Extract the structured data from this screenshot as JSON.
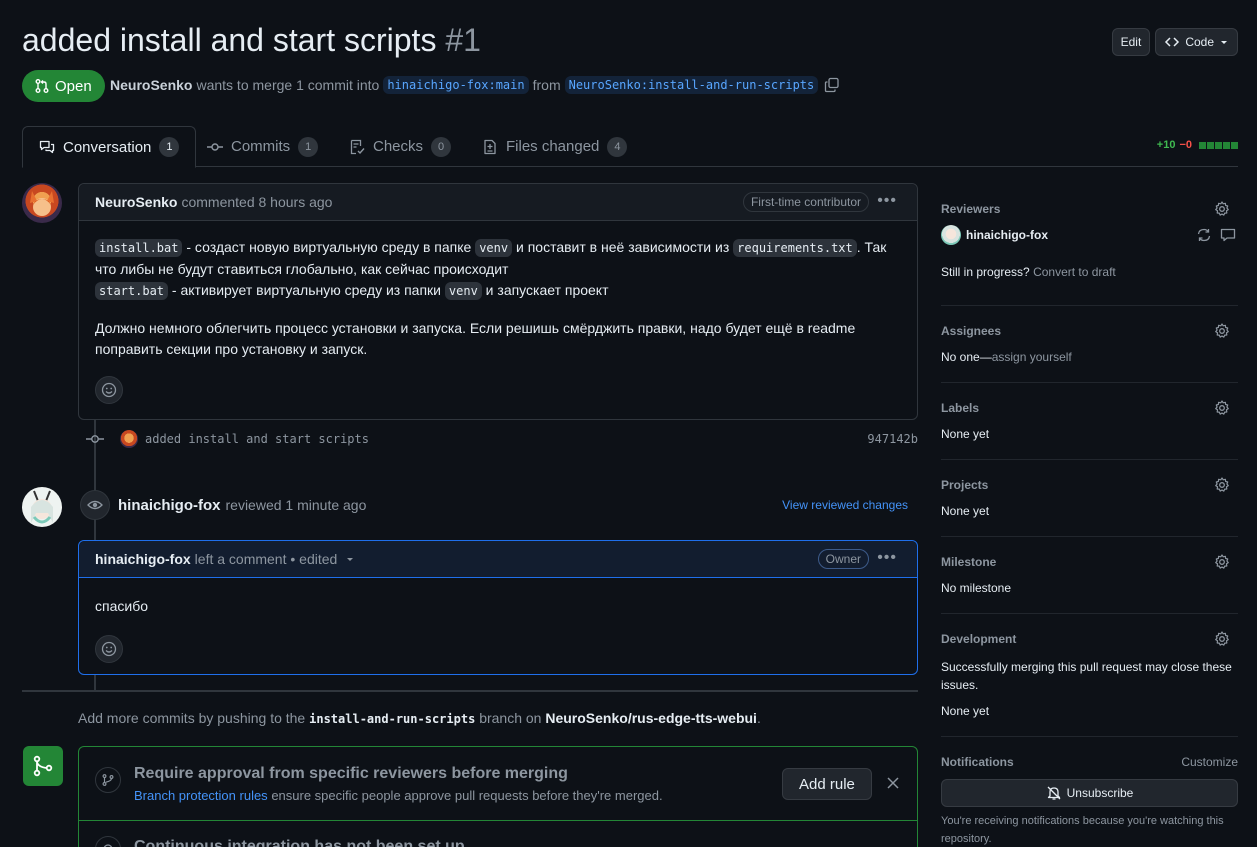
{
  "header": {
    "title": "added install and start scripts",
    "number": "#1",
    "edit_label": "Edit",
    "code_label": "Code",
    "state_label": "Open",
    "author": "NeuroSenko",
    "merge_text": "wants to merge 1 commit into",
    "base_branch": "hinaichigo-fox:main",
    "from_text": "from",
    "head_branch": "NeuroSenko:install-and-run-scripts"
  },
  "tabs": [
    {
      "label": "Conversation",
      "count": "1"
    },
    {
      "label": "Commits",
      "count": "1"
    },
    {
      "label": "Checks",
      "count": "0"
    },
    {
      "label": "Files changed",
      "count": "4"
    }
  ],
  "diffstat": {
    "additions": "+10",
    "deletions": "−0"
  },
  "comment1": {
    "author": "NeuroSenko",
    "action": "commented 8 hours ago",
    "badge": "First-time contributor",
    "code1": "install.bat",
    "text1": " - создаст новую виртуальную среду в папке ",
    "code2": "venv",
    "text2": " и поставит в неё зависимости из ",
    "code3": "requirements.txt",
    "text3": ". Так что либы не будут ставиться глобально, как сейчас происходит",
    "code4": "start.bat",
    "text4": " - активирует виртуальную среду из папки ",
    "code5": "venv",
    "text5": " и запускает проект",
    "paragraph2": "Должно немного облегчить процесс установки и запуска. Если решишь смёрджить правки, надо будет ещё в readme поправить секции про установку и запуск."
  },
  "commit": {
    "message": "added install and start scripts",
    "sha": "947142b"
  },
  "review": {
    "author": "hinaichigo-fox",
    "action": "reviewed 1 minute ago",
    "link": "View reviewed changes"
  },
  "comment2": {
    "author": "hinaichigo-fox",
    "action": "left a comment • edited",
    "badge": "Owner",
    "body": "спасибо"
  },
  "hint": {
    "prefix": "Add more commits by pushing to the",
    "branch": "install-and-run-scripts",
    "middle": "branch on",
    "repo": "NeuroSenko/rus-edge-tts-webui",
    "suffix": "."
  },
  "merge": {
    "rule_title": "Require approval from specific reviewers before merging",
    "rule_link": "Branch protection rules",
    "rule_desc": "ensure specific people approve pull requests before they're merged.",
    "add_rule_label": "Add rule",
    "ci_title": "Continuous integration has not been set up"
  },
  "sidebar": {
    "reviewers_title": "Reviewers",
    "reviewer_name": "hinaichigo-fox",
    "progress_text": "Still in progress?",
    "convert_link": "Convert to draft",
    "assignees_title": "Assignees",
    "assignees_val": "No one—",
    "assign_link": "assign yourself",
    "labels_title": "Labels",
    "labels_val": "None yet",
    "projects_title": "Projects",
    "projects_val": "None yet",
    "milestone_title": "Milestone",
    "milestone_val": "No milestone",
    "development_title": "Development",
    "development_desc": "Successfully merging this pull request may close these issues.",
    "development_val": "None yet",
    "notifications_title": "Notifications",
    "customize_link": "Customize",
    "unsubscribe_label": "Unsubscribe",
    "notif_text": "You're receiving notifications because you're watching this repository."
  },
  "colors": {
    "accent": "#4493f8",
    "open_green": "#238636",
    "bg": "#0d1117"
  }
}
